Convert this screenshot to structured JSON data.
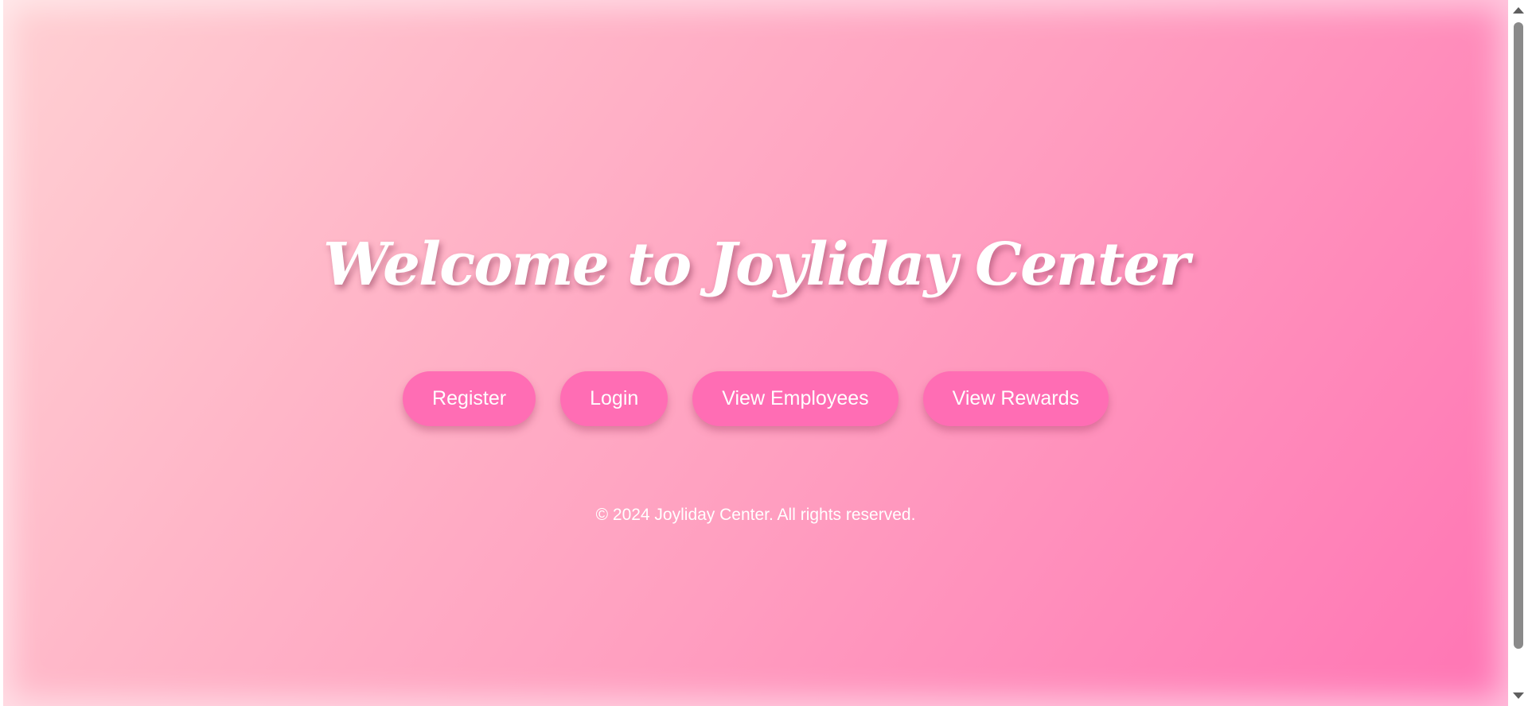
{
  "header": {
    "title": "Welcome to Joyliday Center"
  },
  "nav": {
    "buttons": [
      {
        "label": "Register"
      },
      {
        "label": "Login"
      },
      {
        "label": "View Employees"
      },
      {
        "label": "View Rewards"
      }
    ]
  },
  "footer": {
    "text": "© 2024 Joyliday Center. All rights reserved."
  },
  "colors": {
    "button_bg": "#ff6db4",
    "gradient_start": "#ffd0d3",
    "gradient_end": "#ff74b4",
    "text": "#ffffff"
  }
}
